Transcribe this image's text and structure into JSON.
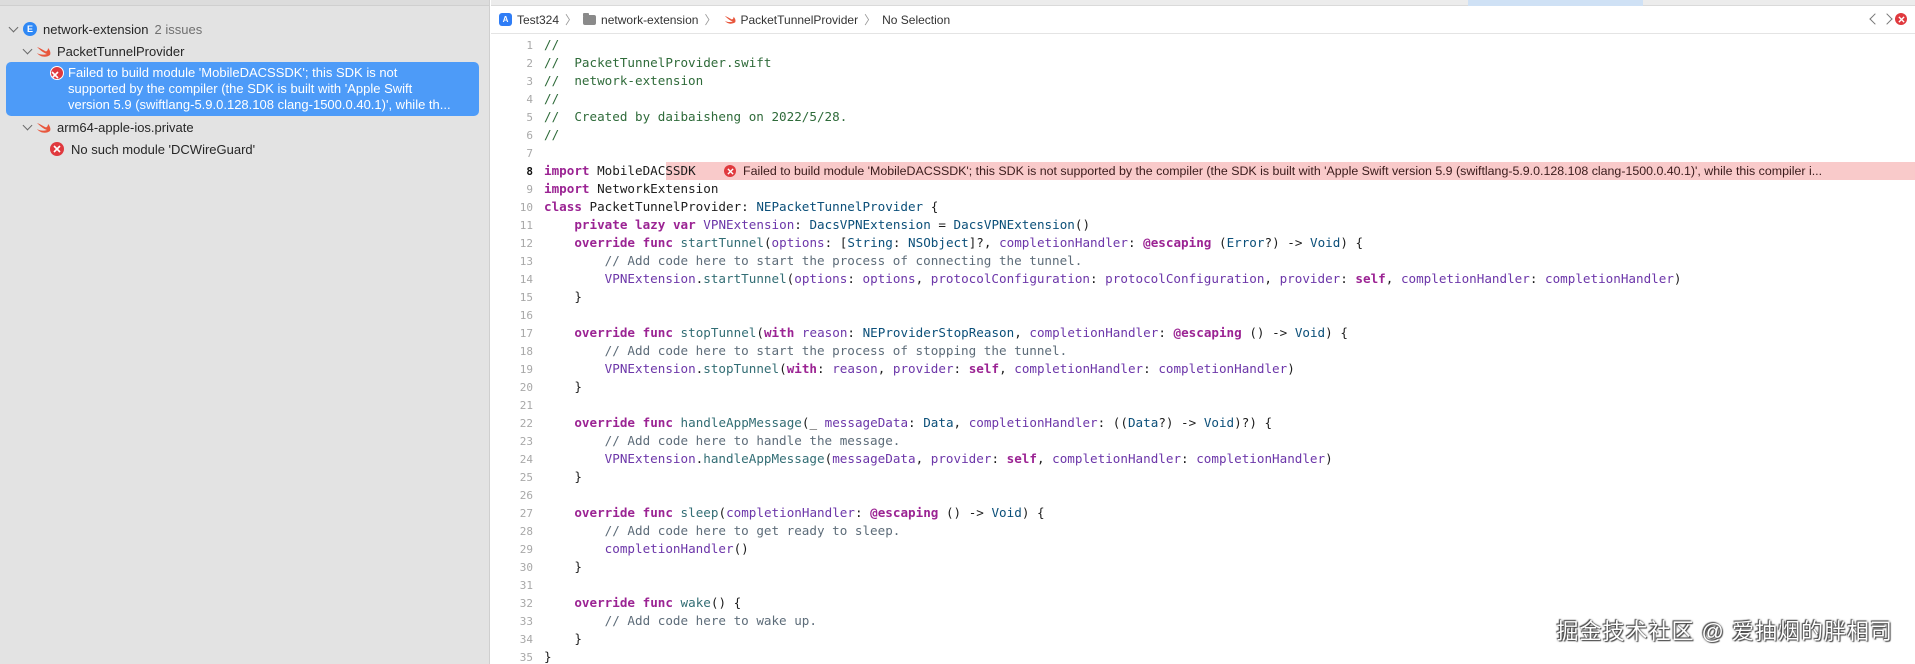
{
  "navigator": {
    "project": {
      "name": "network-extension",
      "issues": "2 issues"
    },
    "groups": [
      {
        "name": "PacketTunnelProvider",
        "issue_lines": [
          "Failed to build module 'MobileDACSSDK'; this SDK is not",
          "supported by the compiler (the SDK is built with 'Apple Swift",
          "version 5.9 (swiftlang-5.9.0.128.108 clang-1500.0.40.1)', while th..."
        ]
      },
      {
        "name": "arm64-apple-ios.private",
        "issue": "No such module 'DCWireGuard'"
      }
    ]
  },
  "jumpbar": {
    "crumbs": [
      "Test324",
      "network-extension",
      "PacketTunnelProvider",
      "No Selection"
    ]
  },
  "editor": {
    "inline_error": "Failed to build module 'MobileDACSSDK'; this SDK is not supported by the compiler (the SDK is built with 'Apple Swift version 5.9 (swiftlang-5.9.0.128.108 clang-1500.0.40.1)', while this compiler i...",
    "lines": [
      [
        "1",
        "//"
      ],
      [
        "2",
        "//  PacketTunnelProvider.swift"
      ],
      [
        "3",
        "//  network-extension"
      ],
      [
        "4",
        "//"
      ],
      [
        "5",
        "//  Created by daibaisheng on 2022/5/28."
      ],
      [
        "6",
        "//"
      ],
      [
        "7",
        ""
      ],
      [
        "8",
        "import MobileDACSSDK"
      ],
      [
        "9",
        "import NetworkExtension"
      ],
      [
        "10",
        "class PacketTunnelProvider: NEPacketTunnelProvider {"
      ],
      [
        "11",
        "    private lazy var VPNExtension: DacsVPNExtension = DacsVPNExtension()"
      ],
      [
        "12",
        "    override func startTunnel(options: [String: NSObject]?, completionHandler: @escaping (Error?) -> Void) {"
      ],
      [
        "13",
        "        // Add code here to start the process of connecting the tunnel."
      ],
      [
        "14",
        "        VPNExtension.startTunnel(options: options, protocolConfiguration: protocolConfiguration, provider: self, completionHandler: completionHandler)"
      ],
      [
        "15",
        "    }"
      ],
      [
        "16",
        ""
      ],
      [
        "17",
        "    override func stopTunnel(with reason: NEProviderStopReason, completionHandler: @escaping () -> Void) {"
      ],
      [
        "18",
        "        // Add code here to start the process of stopping the tunnel."
      ],
      [
        "19",
        "        VPNExtension.stopTunnel(with: reason, provider: self, completionHandler: completionHandler)"
      ],
      [
        "20",
        "    }"
      ],
      [
        "21",
        ""
      ],
      [
        "22",
        "    override func handleAppMessage(_ messageData: Data, completionHandler: ((Data?) -> Void)?) {"
      ],
      [
        "23",
        "        // Add code here to handle the message."
      ],
      [
        "24",
        "        VPNExtension.handleAppMessage(messageData, provider: self, completionHandler: completionHandler)"
      ],
      [
        "25",
        "    }"
      ],
      [
        "26",
        ""
      ],
      [
        "27",
        "    override func sleep(completionHandler: @escaping () -> Void) {"
      ],
      [
        "28",
        "        // Add code here to get ready to sleep."
      ],
      [
        "29",
        "        completionHandler()"
      ],
      [
        "30",
        "    }"
      ],
      [
        "31",
        ""
      ],
      [
        "32",
        "    override func wake() {"
      ],
      [
        "33",
        "        // Add code here to wake up."
      ],
      [
        "34",
        "    }"
      ],
      [
        "35",
        "}"
      ]
    ]
  },
  "watermark": "掘金技术社区 @ 爱抽烟的胖相司",
  "colors": {
    "selection": "#4d9bf8",
    "error": "#e0393e",
    "error_line_bg": "#f9caca",
    "keyword": "#9b2393"
  }
}
